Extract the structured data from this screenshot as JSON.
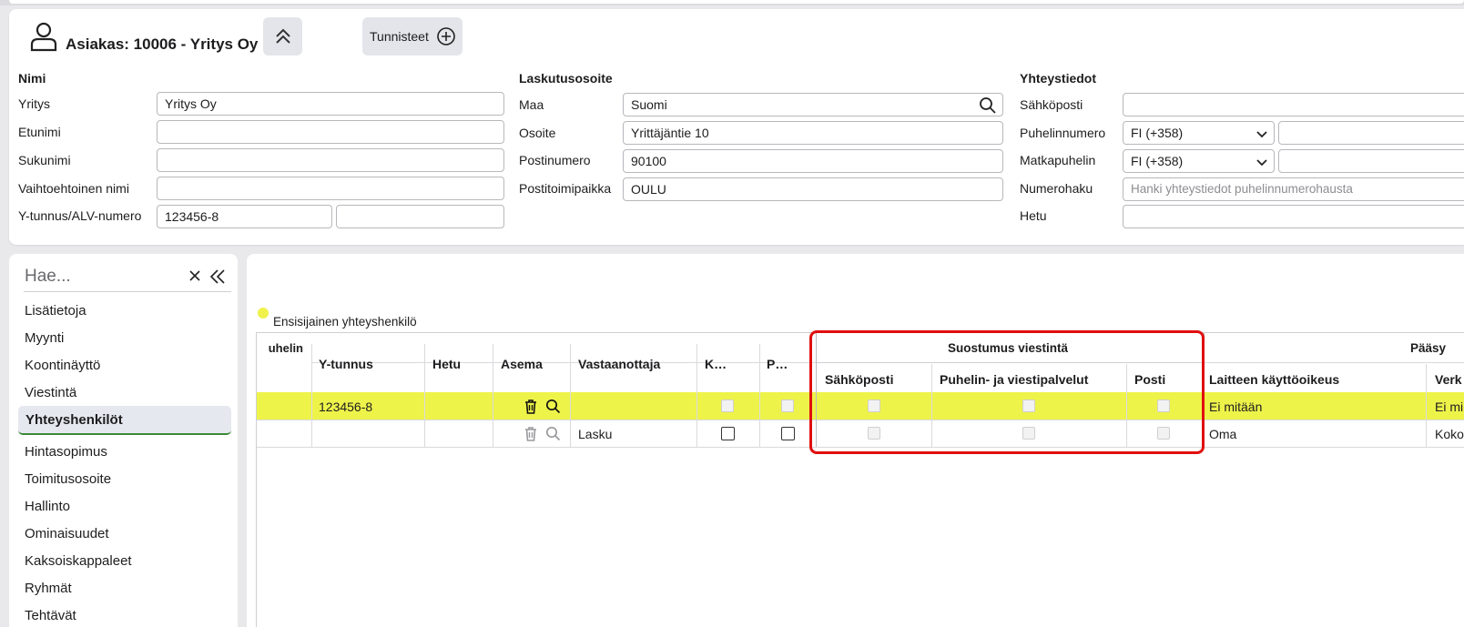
{
  "customer": {
    "title": "Asiakas: 10006 - Yritys Oy",
    "tags_label": "Tunnisteet"
  },
  "name_section": {
    "title": "Nimi",
    "company_label": "Yritys",
    "company_value": "Yritys Oy",
    "first_name_label": "Etunimi",
    "first_name_value": "",
    "last_name_label": "Sukunimi",
    "last_name_value": "",
    "alt_name_label": "Vaihtoehtoinen nimi",
    "alt_name_value": "",
    "business_id_label": "Y-tunnus/ALV-numero",
    "business_id_value": "123456-8",
    "vat_value": ""
  },
  "billing": {
    "title": "Laskutusosoite",
    "country_label": "Maa",
    "country_value": "Suomi",
    "address_label": "Osoite",
    "address_value": "Yrittäjäntie 10",
    "postal_code_label": "Postinumero",
    "postal_code_value": "90100",
    "city_label": "Postitoimipaikka",
    "city_value": "OULU"
  },
  "contact": {
    "title": "Yhteystiedot",
    "email_label": "Sähköposti",
    "email_value": "",
    "phone_label": "Puhelinnumero",
    "phone_country": "FI (+358)",
    "mobile_label": "Matkapuhelin",
    "mobile_country": "FI (+358)",
    "lookup_label": "Numerohaku",
    "lookup_placeholder": "Hanki yhteystiedot puhelinnumerohausta",
    "ssn_label": "Hetu",
    "ssn_value": ""
  },
  "sidebar": {
    "search_placeholder": "Hae...",
    "items": [
      {
        "label": "Lisätietoja"
      },
      {
        "label": "Myynti"
      },
      {
        "label": "Koontinäyttö"
      },
      {
        "label": "Viestintä"
      },
      {
        "label": "Yhteyshenkilöt",
        "active": true
      },
      {
        "label": "Hintasopimus"
      },
      {
        "label": "Toimitusosoite"
      },
      {
        "label": "Hallinto"
      },
      {
        "label": "Ominaisuudet"
      },
      {
        "label": "Kaksoiskappaleet"
      },
      {
        "label": "Ryhmät"
      },
      {
        "label": "Tehtävät"
      }
    ]
  },
  "contacts_table": {
    "legend": "Ensisijainen yhteyshenkilö",
    "group_headers": {
      "consent": "Suostumus viestintä",
      "access": "Pääsy"
    },
    "columns": [
      "uhelin",
      "Y-tunnus",
      "Hetu",
      "Asema",
      "Vastaanottaja",
      "K…",
      "P…",
      "Sähköposti",
      "Puhelin- ja viestipalvelut",
      "Posti",
      "Laitteen käyttöoikeus",
      "Verk"
    ],
    "rows": [
      {
        "business_id": "123456-8",
        "recipient": "",
        "device_access": "Ei mitään",
        "web": "Ei mi",
        "primary": true
      },
      {
        "business_id": "",
        "recipient": "Lasku",
        "device_access": "Oma",
        "web": "Koko",
        "primary": false
      }
    ]
  },
  "colors": {
    "primary_row": "#eef34a",
    "highlight_box": "#e00f0f",
    "active_underline": "#3a8a3a"
  }
}
